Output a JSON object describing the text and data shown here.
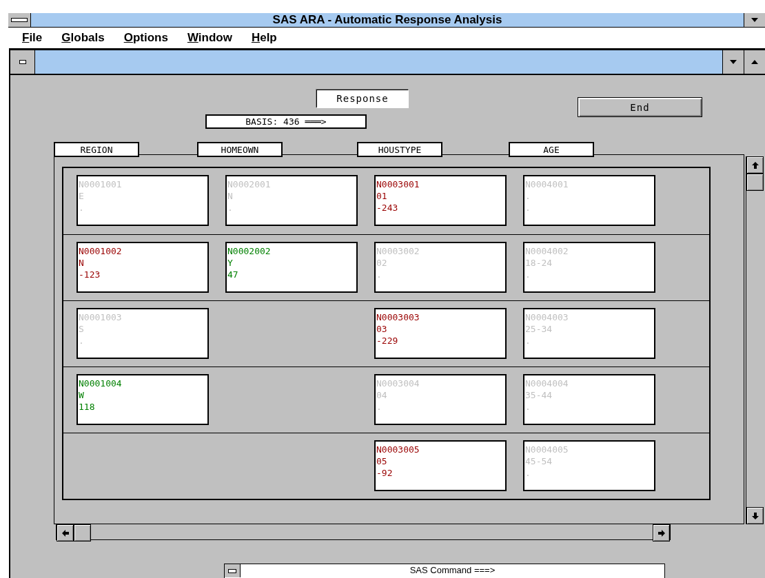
{
  "window": {
    "title": "SAS ARA - Automatic Response Analysis"
  },
  "menu": [
    {
      "label": "File"
    },
    {
      "label": "Globals"
    },
    {
      "label": "Options"
    },
    {
      "label": "Window"
    },
    {
      "label": "Help"
    }
  ],
  "response_label": "Response",
  "basis_label": "BASIS: 436 ═══>",
  "end_button": "End",
  "columns": [
    "REGION",
    "HOMEOWN",
    "HOUSTYPE",
    "AGE"
  ],
  "rows": [
    {
      "cells": [
        {
          "lines": [
            "N0001001",
            "E",
            "."
          ],
          "color": "#c0c0c0"
        },
        {
          "lines": [
            "N0002001",
            "N",
            "."
          ],
          "color": "#c0c0c0"
        },
        {
          "lines": [
            "N0003001",
            "01",
            "-243"
          ],
          "color": "#990000"
        },
        {
          "lines": [
            "N0004001",
            ".",
            "."
          ],
          "color": "#c0c0c0"
        }
      ]
    },
    {
      "cells": [
        {
          "lines": [
            "N0001002",
            "N",
            "-123"
          ],
          "color": "#990000"
        },
        {
          "lines": [
            "N0002002",
            "Y",
            "47"
          ],
          "color": "#008000"
        },
        {
          "lines": [
            "N0003002",
            "02",
            "."
          ],
          "color": "#c0c0c0"
        },
        {
          "lines": [
            "N0004002",
            "18-24",
            "."
          ],
          "color": "#c0c0c0"
        }
      ]
    },
    {
      "cells": [
        {
          "lines": [
            "N0001003",
            "S",
            "."
          ],
          "color": "#c0c0c0"
        },
        null,
        {
          "lines": [
            "N0003003",
            "03",
            "-229"
          ],
          "color": "#990000"
        },
        {
          "lines": [
            "N0004003",
            "25-34",
            "."
          ],
          "color": "#c0c0c0"
        }
      ]
    },
    {
      "cells": [
        {
          "lines": [
            "N0001004",
            "W",
            "118"
          ],
          "color": "#008000"
        },
        null,
        {
          "lines": [
            "N0003004",
            "04",
            "."
          ],
          "color": "#c0c0c0"
        },
        {
          "lines": [
            "N0004004",
            "35-44",
            "."
          ],
          "color": "#c0c0c0"
        }
      ]
    },
    {
      "cells": [
        null,
        null,
        {
          "lines": [
            "N0003005",
            "05",
            "-92"
          ],
          "color": "#990000"
        },
        {
          "lines": [
            "N0004005",
            "45-54",
            "."
          ],
          "color": "#c0c0c0"
        }
      ]
    }
  ],
  "command_bar": "SAS Command ===>"
}
